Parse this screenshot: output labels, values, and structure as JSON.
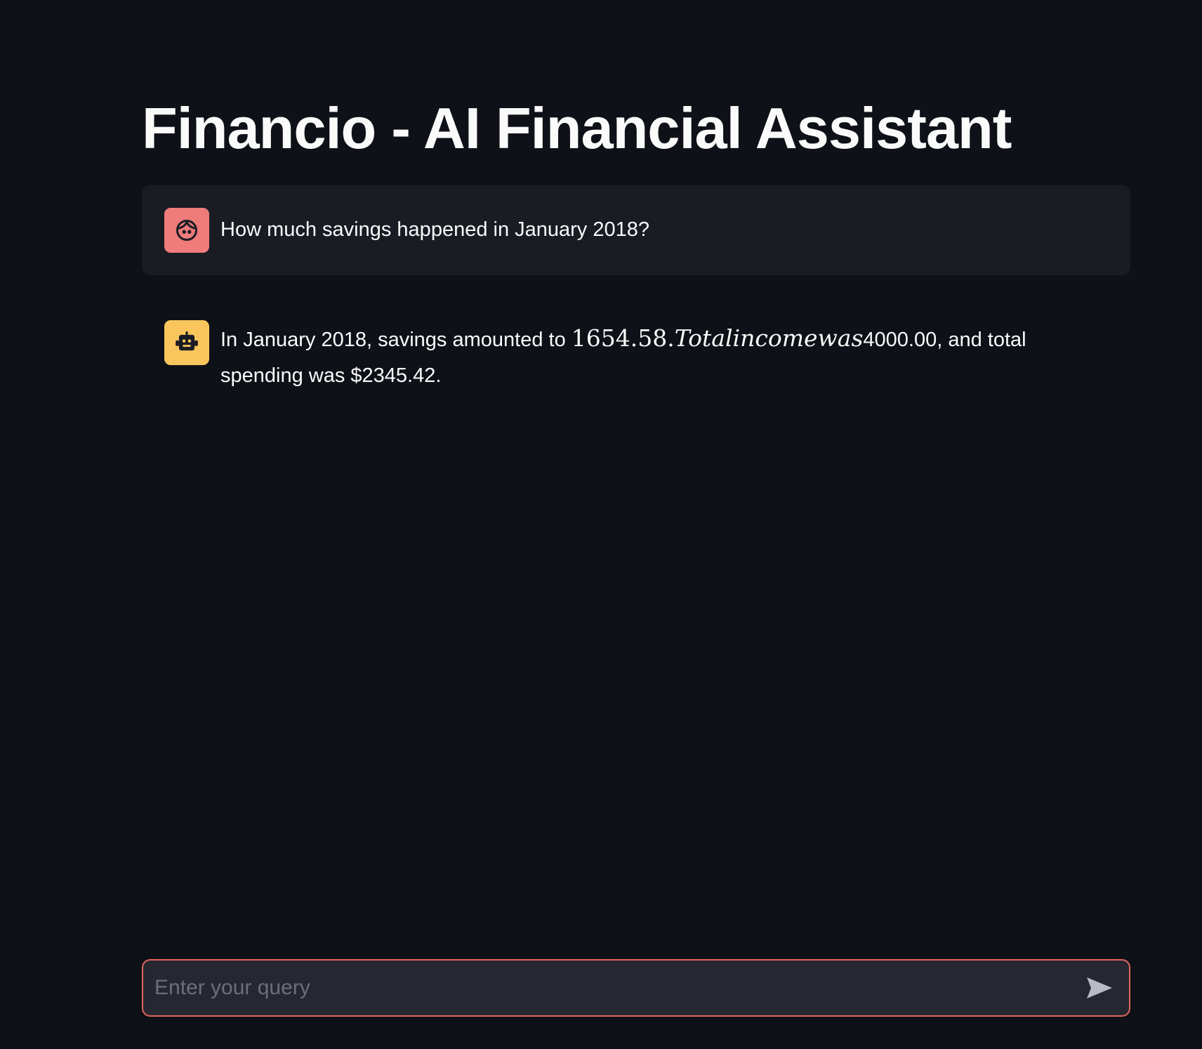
{
  "page": {
    "title": "Financio - AI Financial Assistant"
  },
  "chat": {
    "messages": [
      {
        "role": "user",
        "avatar_icon": "user-face-icon",
        "avatar_color": "#ef7b7b",
        "text": "How much savings happened in January 2018?"
      },
      {
        "role": "assistant",
        "avatar_icon": "robot-icon",
        "avatar_color": "#f8c65c",
        "text_before": "In January 2018, savings amounted to ",
        "math_number": "1654.58.",
        "math_text": "Totalincomewas",
        "text_after": "4000.00, and total spending was $2345.42."
      }
    ]
  },
  "input": {
    "placeholder": "Enter your query",
    "value": "",
    "send_icon": "send-icon",
    "border_color": "#e2655f"
  },
  "colors": {
    "background": "#0e1117",
    "user_bubble": "#1a1c24",
    "text": "#fafafa"
  }
}
